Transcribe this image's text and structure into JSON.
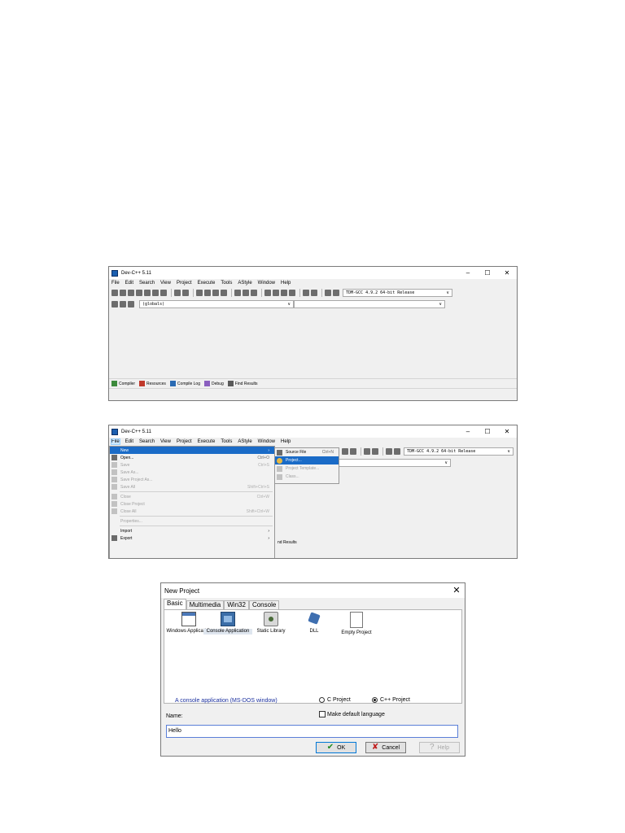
{
  "devcpp": {
    "title": "Dev-C++ 5.11",
    "window_controls": [
      "–",
      "☐",
      "✕"
    ],
    "menu": [
      "File",
      "Edit",
      "Search",
      "View",
      "Project",
      "Execute",
      "Tools",
      "AStyle",
      "Window",
      "Help"
    ],
    "compiler": "TDM-GCC 4.9.2 64-bit Release",
    "scope": "(globals)",
    "bottom_tabs": [
      "Compiler",
      "Resources",
      "Compile Log",
      "Debug",
      "Find Results"
    ]
  },
  "file_menu": {
    "items": [
      {
        "label": "New",
        "shortcut": "",
        "arrow": "›"
      },
      {
        "label": "Open...",
        "shortcut": "Ctrl+O"
      },
      {
        "label": "Save",
        "shortcut": "Ctrl+S"
      },
      {
        "label": "Save As...",
        "shortcut": ""
      },
      {
        "label": "Save Project As...",
        "shortcut": ""
      },
      {
        "label": "Save All",
        "shortcut": "Shift+Ctrl+S"
      },
      {
        "label": "Close",
        "shortcut": "Ctrl+W"
      },
      {
        "label": "Close Project",
        "shortcut": ""
      },
      {
        "label": "Close All",
        "shortcut": "Shift+Ctrl+W"
      },
      {
        "label": "Properties...",
        "shortcut": ""
      },
      {
        "label": "Import",
        "shortcut": "",
        "arrow": "›"
      },
      {
        "label": "Export",
        "shortcut": "",
        "arrow": "›"
      }
    ],
    "submenu": [
      {
        "label": "Source File",
        "shortcut": "Ctrl+N"
      },
      {
        "label": "Project...",
        "shortcut": ""
      },
      {
        "label": "Project Template...",
        "shortcut": ""
      },
      {
        "label": "Class...",
        "shortcut": ""
      }
    ],
    "find_results_fragment": "nd Results"
  },
  "dialog": {
    "title": "New Project",
    "close": "✕",
    "tabs": [
      "Basic",
      "Multimedia",
      "Win32",
      "Console"
    ],
    "templates": [
      {
        "label": "Windows Application"
      },
      {
        "label": "Console Application"
      },
      {
        "label": "Static Library"
      },
      {
        "label": "DLL"
      },
      {
        "label": "Empty Project"
      }
    ],
    "description": "A console application (MS-DOS window)",
    "radio_c": "C Project",
    "radio_cpp": "C++ Project",
    "make_default": "Make default language",
    "name_label": "Name:",
    "name_value": "Hello",
    "ok": "OK",
    "cancel": "Cancel",
    "help": "Help"
  }
}
